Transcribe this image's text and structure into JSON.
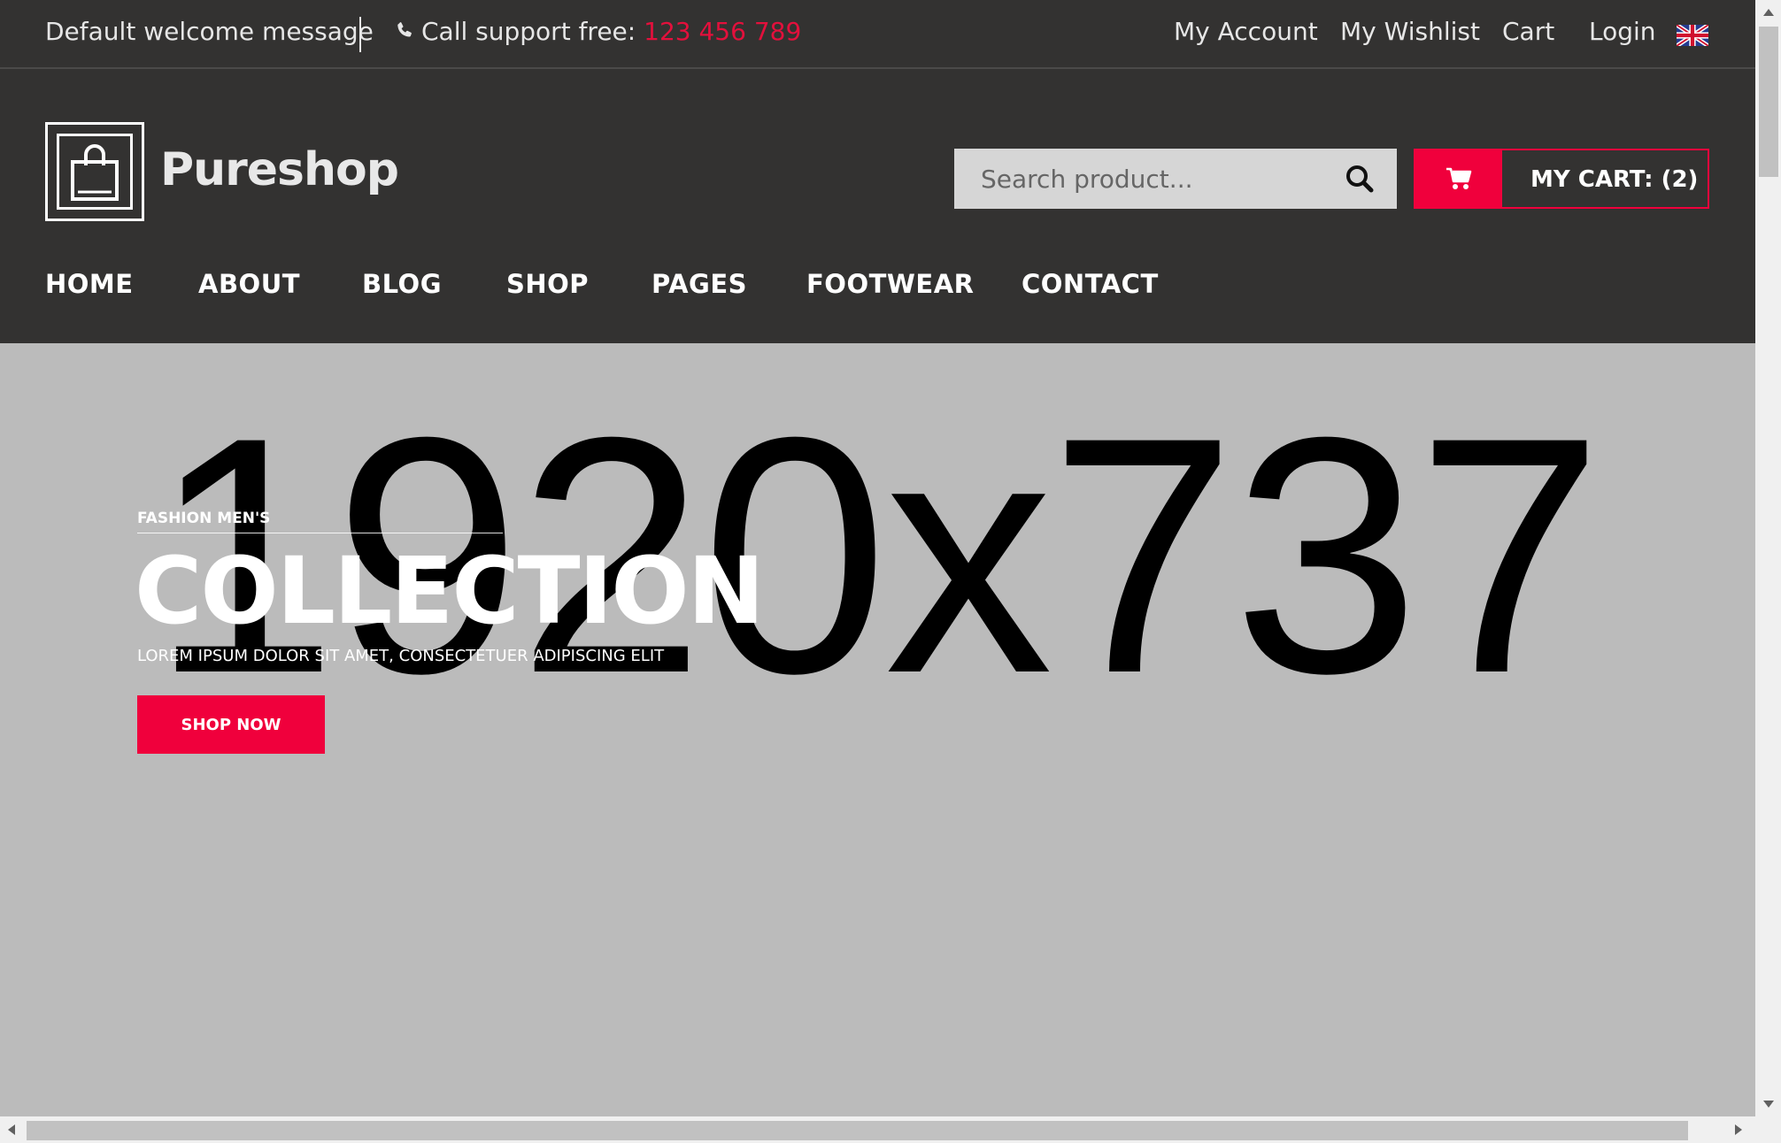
{
  "topbar": {
    "welcome": "Default welcome message",
    "support_label": "Call support free: ",
    "support_number": "123 456 789",
    "links": [
      "My Account",
      "My Wishlist",
      "Cart",
      "Login"
    ],
    "language_icon": "uk-flag-icon"
  },
  "header": {
    "logo_text": "Pureshop",
    "search_placeholder": "Search product...",
    "cart_label": "MY CART: (2)"
  },
  "nav": [
    "HOME",
    "ABOUT",
    "BLOG",
    "SHOP",
    "PAGES",
    "FOOTWEAR",
    "CONTACT"
  ],
  "hero": {
    "placeholder_text": "1920x737",
    "kicker": "FASHION MEN'S",
    "headline": "COLLECTION",
    "subline": "LOREM IPSUM DOLOR SIT AMET, CONSECTETUER ADIPISCING ELIT",
    "cta": "SHOP NOW"
  },
  "colors": {
    "accent": "#f0003c",
    "header_bg": "#333231",
    "hero_bg": "#bbbbbb"
  }
}
